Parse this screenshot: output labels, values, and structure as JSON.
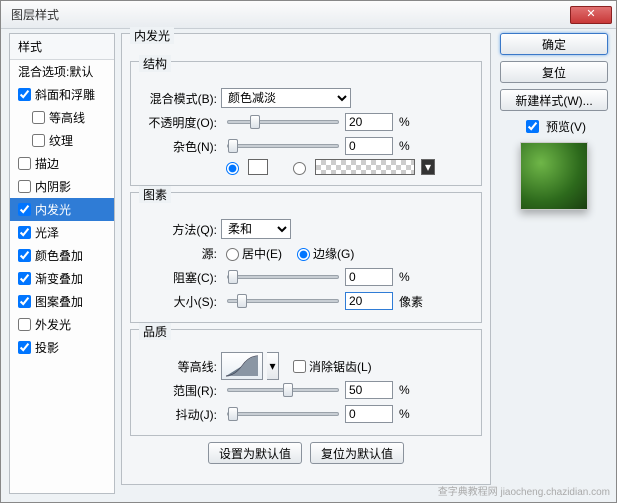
{
  "window": {
    "title": "图层样式"
  },
  "styles": {
    "head": "样式",
    "blend": "混合选项:默认",
    "items": [
      {
        "label": "斜面和浮雕",
        "checked": true,
        "sub": false
      },
      {
        "label": "等高线",
        "checked": false,
        "sub": true
      },
      {
        "label": "纹理",
        "checked": false,
        "sub": true
      },
      {
        "label": "描边",
        "checked": false,
        "sub": false
      },
      {
        "label": "内阴影",
        "checked": false,
        "sub": false
      },
      {
        "label": "内发光",
        "checked": true,
        "sub": false,
        "sel": true
      },
      {
        "label": "光泽",
        "checked": true,
        "sub": false
      },
      {
        "label": "颜色叠加",
        "checked": true,
        "sub": false
      },
      {
        "label": "渐变叠加",
        "checked": true,
        "sub": false
      },
      {
        "label": "图案叠加",
        "checked": true,
        "sub": false
      },
      {
        "label": "外发光",
        "checked": false,
        "sub": false
      },
      {
        "label": "投影",
        "checked": true,
        "sub": false
      }
    ]
  },
  "panel": {
    "title": "内发光",
    "structure": {
      "legend": "结构",
      "blend_mode": {
        "label": "混合模式(B):",
        "value": "颜色减淡"
      },
      "opacity": {
        "label": "不透明度(O):",
        "value": "20",
        "unit": "%",
        "pos": 20
      },
      "noise": {
        "label": "杂色(N):",
        "value": "0",
        "unit": "%",
        "pos": 0
      },
      "color_hex": "#ffffff"
    },
    "elements": {
      "legend": "图素",
      "technique": {
        "label": "方法(Q):",
        "value": "柔和"
      },
      "source": {
        "label": "源:",
        "center": "居中(E)",
        "edge": "边缘(G)"
      },
      "choke": {
        "label": "阻塞(C):",
        "value": "0",
        "unit": "%",
        "pos": 0
      },
      "size": {
        "label": "大小(S):",
        "value": "20",
        "unit": "像素",
        "pos": 8
      }
    },
    "quality": {
      "legend": "品质",
      "contour": {
        "label": "等高线:",
        "antialias": "消除锯齿(L)"
      },
      "range": {
        "label": "范围(R):",
        "value": "50",
        "unit": "%",
        "pos": 50
      },
      "jitter": {
        "label": "抖动(J):",
        "value": "0",
        "unit": "%",
        "pos": 0
      }
    },
    "buttons": {
      "default": "设置为默认值",
      "reset": "复位为默认值"
    }
  },
  "right": {
    "ok": "确定",
    "cancel": "复位",
    "new_style": "新建样式(W)...",
    "preview": "预览(V)"
  },
  "watermark": "查字典教程网 jiaocheng.chazidian.com"
}
